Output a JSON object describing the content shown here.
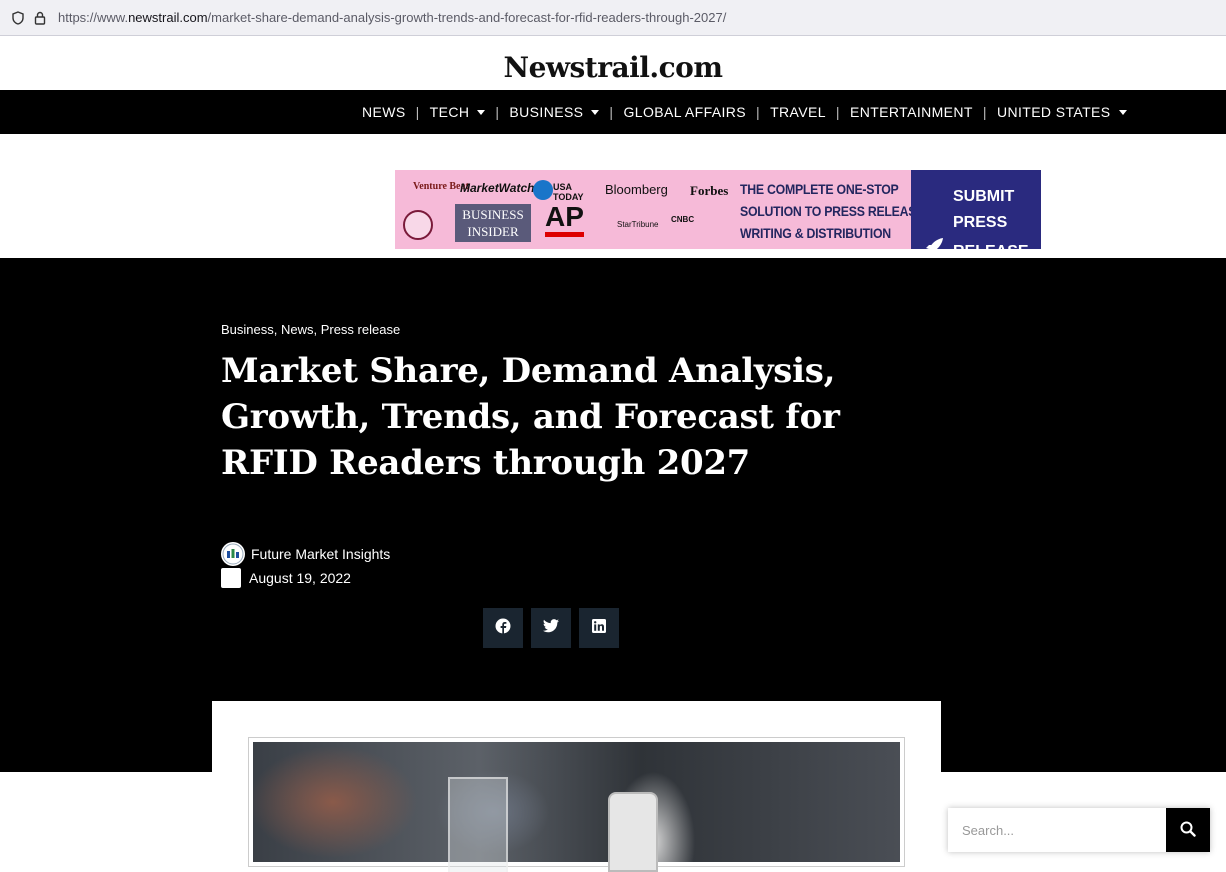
{
  "browser": {
    "url_prefix": "https://www.",
    "url_domain": "newstrail.com",
    "url_path": "/market-share-demand-analysis-growth-trends-and-forecast-for-rfid-readers-through-2027/"
  },
  "site": {
    "logo": "Newstrail.com"
  },
  "nav": {
    "items": [
      {
        "label": "NEWS",
        "dropdown": false
      },
      {
        "label": "TECH",
        "dropdown": true
      },
      {
        "label": "BUSINESS",
        "dropdown": true
      },
      {
        "label": "GLOBAL AFFAIRS",
        "dropdown": false
      },
      {
        "label": "TRAVEL",
        "dropdown": false
      },
      {
        "label": "ENTERTAINMENT",
        "dropdown": false
      },
      {
        "label": "UNITED STATES",
        "dropdown": true
      }
    ]
  },
  "banner": {
    "logos": [
      "Venture Beat",
      "MarketWatch",
      "USA TODAY",
      "Bloomberg",
      "Forbes",
      "BUSINESS INSIDER",
      "AP",
      "StarTribune",
      "CNBC"
    ],
    "headline": "THE COMPLETE ONE-STOP SOLUTION TO PRESS RELEASE WRITING & DISTRIBUTION",
    "headline_lines": [
      "THE COMPLETE ONE-STOP",
      "SOLUTION TO PRESS RELEASE",
      "WRITING & DISTRIBUTION"
    ],
    "cta_lines": [
      "SUBMIT PRESS",
      "RELEASE"
    ]
  },
  "article": {
    "categories": "Business, News, Press release",
    "title": "Market Share, Demand Analysis, Growth, Trends, and Forecast for RFID Readers through 2027",
    "author": "Future Market Insights",
    "date": "August 19, 2022"
  },
  "share": {
    "buttons": [
      "facebook-icon",
      "twitter-icon",
      "linkedin-icon"
    ]
  },
  "search": {
    "placeholder": "Search..."
  }
}
